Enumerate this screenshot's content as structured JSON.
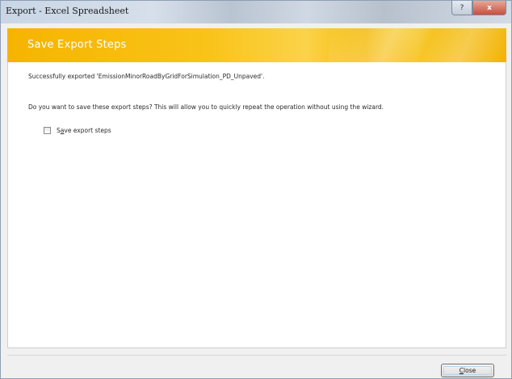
{
  "window": {
    "title": "Export - Excel Spreadsheet",
    "controls": {
      "help_glyph": "?",
      "close_glyph": "x"
    }
  },
  "header": {
    "title": "Save Export Steps",
    "accent_color": "#f6b400"
  },
  "content": {
    "message": "Successfully exported 'EmissionMinorRoadByGridForSimulation_PD_Unpaved'.",
    "question": "Do you want to save these export steps? This will allow you to quickly repeat the operation without using the wizard.",
    "save_steps_checkbox": {
      "label_prefix": "S",
      "label_accel": "a",
      "label_rest": "ve export steps",
      "checked": false
    }
  },
  "footer": {
    "close_button": {
      "label_accel": "C",
      "label_rest": "lose"
    }
  }
}
